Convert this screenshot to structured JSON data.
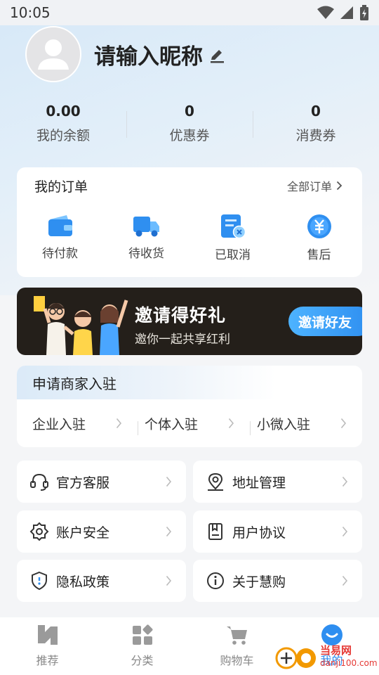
{
  "status_bar": {
    "time": "10:05"
  },
  "profile": {
    "nickname": "请输入昵称"
  },
  "stats": [
    {
      "value": "0.00",
      "label": "我的余额"
    },
    {
      "value": "0",
      "label": "优惠券"
    },
    {
      "value": "0",
      "label": "消费券"
    }
  ],
  "orders": {
    "title": "我的订单",
    "all_label": "全部订单",
    "items": [
      {
        "label": "待付款",
        "icon": "wallet-icon"
      },
      {
        "label": "待收货",
        "icon": "truck-icon"
      },
      {
        "label": "已取消",
        "icon": "cancelled-doc-icon"
      },
      {
        "label": "售后",
        "icon": "yuan-coin-icon"
      }
    ]
  },
  "banner": {
    "title": "邀请得好礼",
    "subtitle": "邀你一起共享红利",
    "button": "邀请好友"
  },
  "merchant": {
    "title": "申请商家入驻",
    "items": [
      {
        "label": "企业入驻"
      },
      {
        "label": "个体入驻"
      },
      {
        "label": "小微入驻"
      }
    ]
  },
  "menu": [
    {
      "label": "官方客服",
      "icon": "headset-icon"
    },
    {
      "label": "地址管理",
      "icon": "location-pin-icon"
    },
    {
      "label": "账户安全",
      "icon": "gear-icon"
    },
    {
      "label": "用户协议",
      "icon": "document-icon"
    },
    {
      "label": "隐私政策",
      "icon": "shield-icon"
    },
    {
      "label": "关于慧购",
      "icon": "info-icon"
    }
  ],
  "bottom_nav": [
    {
      "label": "推荐",
      "icon": "home-logo-icon"
    },
    {
      "label": "分类",
      "icon": "category-grid-icon"
    },
    {
      "label": "购物车",
      "icon": "cart-icon"
    },
    {
      "label": "我的",
      "icon": "profile-smile-icon",
      "active": true
    }
  ],
  "watermark": {
    "text": "当易网",
    "sub": "danji100.com"
  },
  "colors": {
    "accent": "#2e8ef0",
    "banner_bg": "#241f1a"
  }
}
